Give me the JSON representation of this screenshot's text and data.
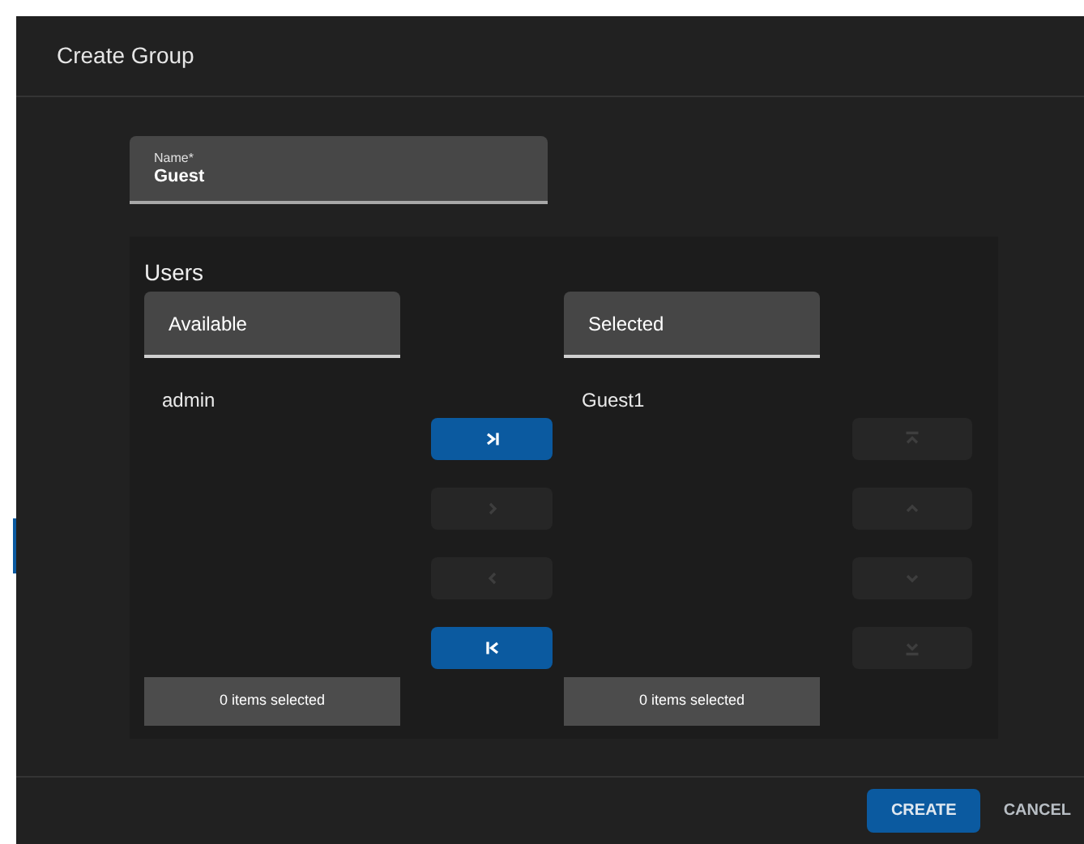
{
  "dialog": {
    "title": "Create Group"
  },
  "name_field": {
    "label": "Name*",
    "value": "Guest"
  },
  "users": {
    "title": "Users",
    "available": {
      "header": "Available",
      "items": [
        "admin"
      ],
      "footer": "0 items selected"
    },
    "selected": {
      "header": "Selected",
      "items": [
        "Guest1"
      ],
      "footer": "0 items selected"
    },
    "transfer_buttons": [
      {
        "kind": "all-right",
        "disabled": false
      },
      {
        "kind": "right",
        "disabled": true
      },
      {
        "kind": "left",
        "disabled": true
      },
      {
        "kind": "all-left",
        "disabled": false
      }
    ],
    "order_buttons": [
      {
        "kind": "top",
        "disabled": true
      },
      {
        "kind": "up",
        "disabled": true
      },
      {
        "kind": "down",
        "disabled": true
      },
      {
        "kind": "bottom",
        "disabled": true
      }
    ]
  },
  "buttons": [
    {
      "label": "CREATE",
      "kind": "primary"
    },
    {
      "label": "CANCEL",
      "kind": "text"
    }
  ]
}
